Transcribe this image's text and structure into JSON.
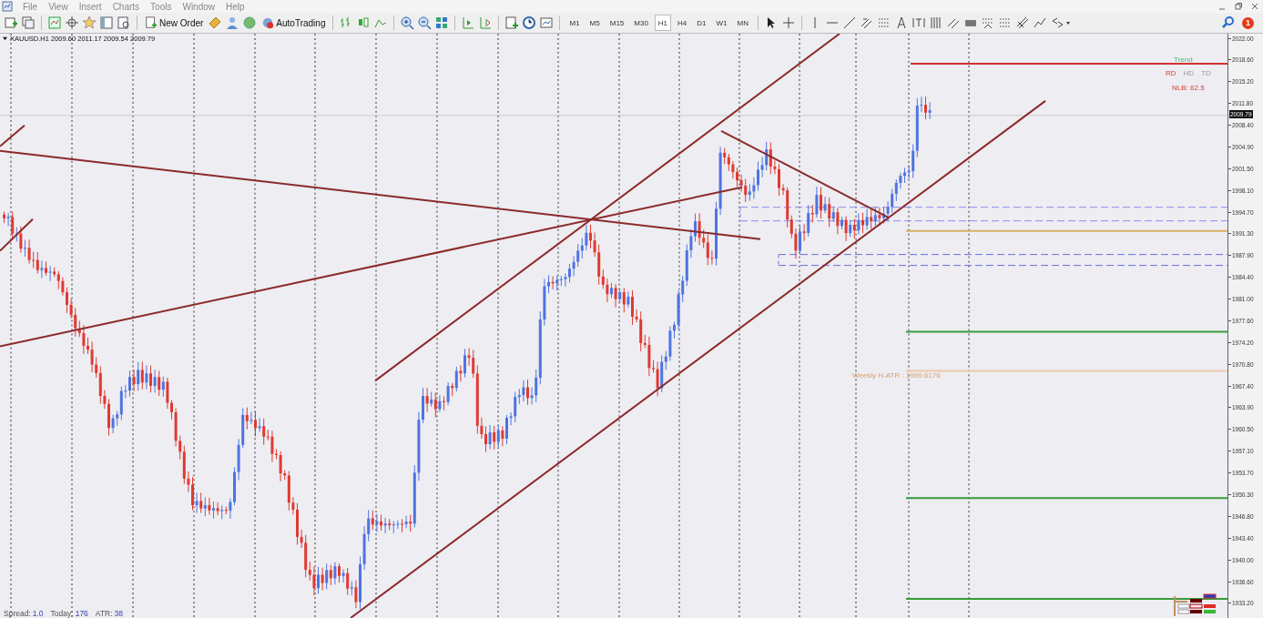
{
  "menu": [
    "File",
    "View",
    "Insert",
    "Charts",
    "Tools",
    "Window",
    "Help"
  ],
  "toolbar": {
    "new_order": "New Order",
    "auto_trading": "AutoTrading"
  },
  "timeframes": [
    {
      "label": "M1",
      "selected": false
    },
    {
      "label": "M5",
      "selected": false
    },
    {
      "label": "M15",
      "selected": false
    },
    {
      "label": "M30",
      "selected": false
    },
    {
      "label": "H1",
      "selected": true
    },
    {
      "label": "H4",
      "selected": false
    },
    {
      "label": "D1",
      "selected": false
    },
    {
      "label": "W1",
      "selected": false
    },
    {
      "label": "MN",
      "selected": false
    }
  ],
  "notification_count": "1",
  "chart": {
    "header": "XAUUSD.H1  2009.60 2011.17 2009.54 2009.79",
    "trend_label": "Trend",
    "trend_states": [
      {
        "label": "RD",
        "active": true
      },
      {
        "label": "HD",
        "active": false
      },
      {
        "label": "TD",
        "active": false
      }
    ],
    "nlb": "NLB: 62.5",
    "weekly_atr": "Weekly H-ATR : 1969.6176",
    "current_price": "2009.79",
    "price_axis": [
      "2022.00",
      "2018.60",
      "2015.20",
      "2011.80",
      "2008.40",
      "2004.90",
      "2001.50",
      "1998.10",
      "1994.70",
      "1991.30",
      "1987.90",
      "1984.40",
      "1981.00",
      "1977.60",
      "1974.20",
      "1970.80",
      "1967.40",
      "1963.90",
      "1960.50",
      "1957.10",
      "1953.70",
      "1950.30",
      "1946.80",
      "1943.40",
      "1940.00",
      "1936.60",
      "1933.20"
    ],
    "status": [
      {
        "label": "Spread:",
        "value": "1.0"
      },
      {
        "label": "Today:",
        "value": "176"
      },
      {
        "label": "ATR:",
        "value": "38"
      }
    ]
  }
}
